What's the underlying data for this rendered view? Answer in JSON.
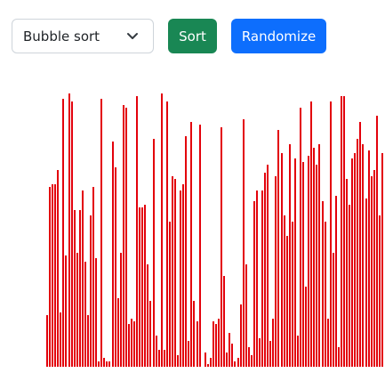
{
  "controls": {
    "algorithm_select": {
      "selected": "Bubble sort",
      "icon": "chevron-down-icon"
    },
    "sort_label": "Sort",
    "randomize_label": "Randomize",
    "colors": {
      "sort": "#198754",
      "randomize": "#0d6efd",
      "bar": "#e3000b"
    }
  },
  "array_values": [
    0.18,
    0.63,
    0.64,
    0.64,
    0.69,
    0.19,
    0.94,
    0.39,
    0.96,
    0.93,
    0.55,
    0.4,
    0.55,
    0.62,
    0.37,
    0.18,
    0.53,
    0.63,
    0.38,
    0.02,
    0.94,
    0.03,
    0.02,
    0.02,
    0.79,
    0.7,
    0.24,
    0.4,
    0.92,
    0.91,
    0.15,
    0.17,
    0.16,
    0.95,
    0.56,
    0.56,
    0.57,
    0.36,
    0.23,
    0.8,
    0.11,
    0.06,
    0.96,
    0.06,
    0.93,
    0.51,
    0.67,
    0.66,
    0.04,
    0.62,
    0.64,
    0.81,
    0.09,
    0.86,
    0.23,
    0.16,
    0.85,
    0.0,
    0.05,
    0.01,
    0.03,
    0.16,
    0.15,
    0.17,
    0.84,
    0.32,
    0.05,
    0.12,
    0.08,
    0.02,
    0.03,
    0.22,
    0.87,
    0.36,
    0.07,
    0.04,
    0.58,
    0.62,
    0.1,
    0.62,
    0.68,
    0.71,
    0.09,
    0.17,
    0.67,
    0.83,
    0.75,
    0.53,
    0.46,
    0.78,
    0.51,
    0.73,
    0.11,
    0.91,
    0.72,
    0.28,
    0.74,
    0.93,
    0.77,
    0.71,
    0.78,
    0.58,
    0.51,
    0.17,
    0.93,
    0.4,
    0.6,
    0.07,
    0.95,
    0.95,
    0.66,
    0.57,
    0.73,
    0.75,
    0.8,
    0.86,
    0.78,
    0.59,
    0.76,
    0.67,
    0.69,
    0.88,
    0.53,
    0.75
  ]
}
